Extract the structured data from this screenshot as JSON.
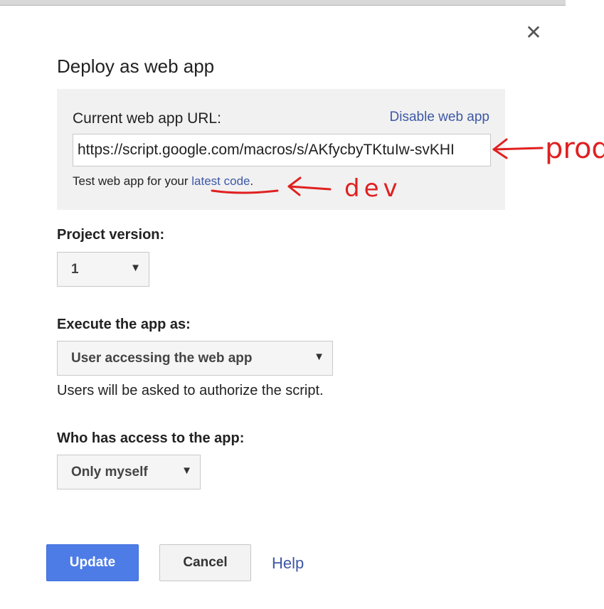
{
  "dialog": {
    "title": "Deploy as web app",
    "close_symbol": "✕"
  },
  "url_section": {
    "label": "Current web app URL:",
    "disable_link": "Disable web app",
    "url_value": "https://script.google.com/macros/s/AKfycbyTKtuIw-svKHI",
    "test_prefix": "Test web app for your ",
    "test_link": "latest code",
    "test_suffix": "."
  },
  "project_version": {
    "label": "Project version:",
    "value": "1"
  },
  "execute_as": {
    "label": "Execute the app as:",
    "value": "User accessing the web app",
    "hint": "Users will be asked to authorize the script."
  },
  "access": {
    "label": "Who has access to the app:",
    "value": "Only myself"
  },
  "buttons": {
    "update": "Update",
    "cancel": "Cancel",
    "help": "Help"
  },
  "annotations": {
    "prod": "prod",
    "dev": "dev",
    "color": "#e02020"
  },
  "icons": {
    "close": "close-icon",
    "dropdown": "dropdown-arrow-icon"
  },
  "colors": {
    "primary_button": "#4d7ce6",
    "link": "#3d58a5",
    "panel_bg": "#f1f1f1"
  }
}
